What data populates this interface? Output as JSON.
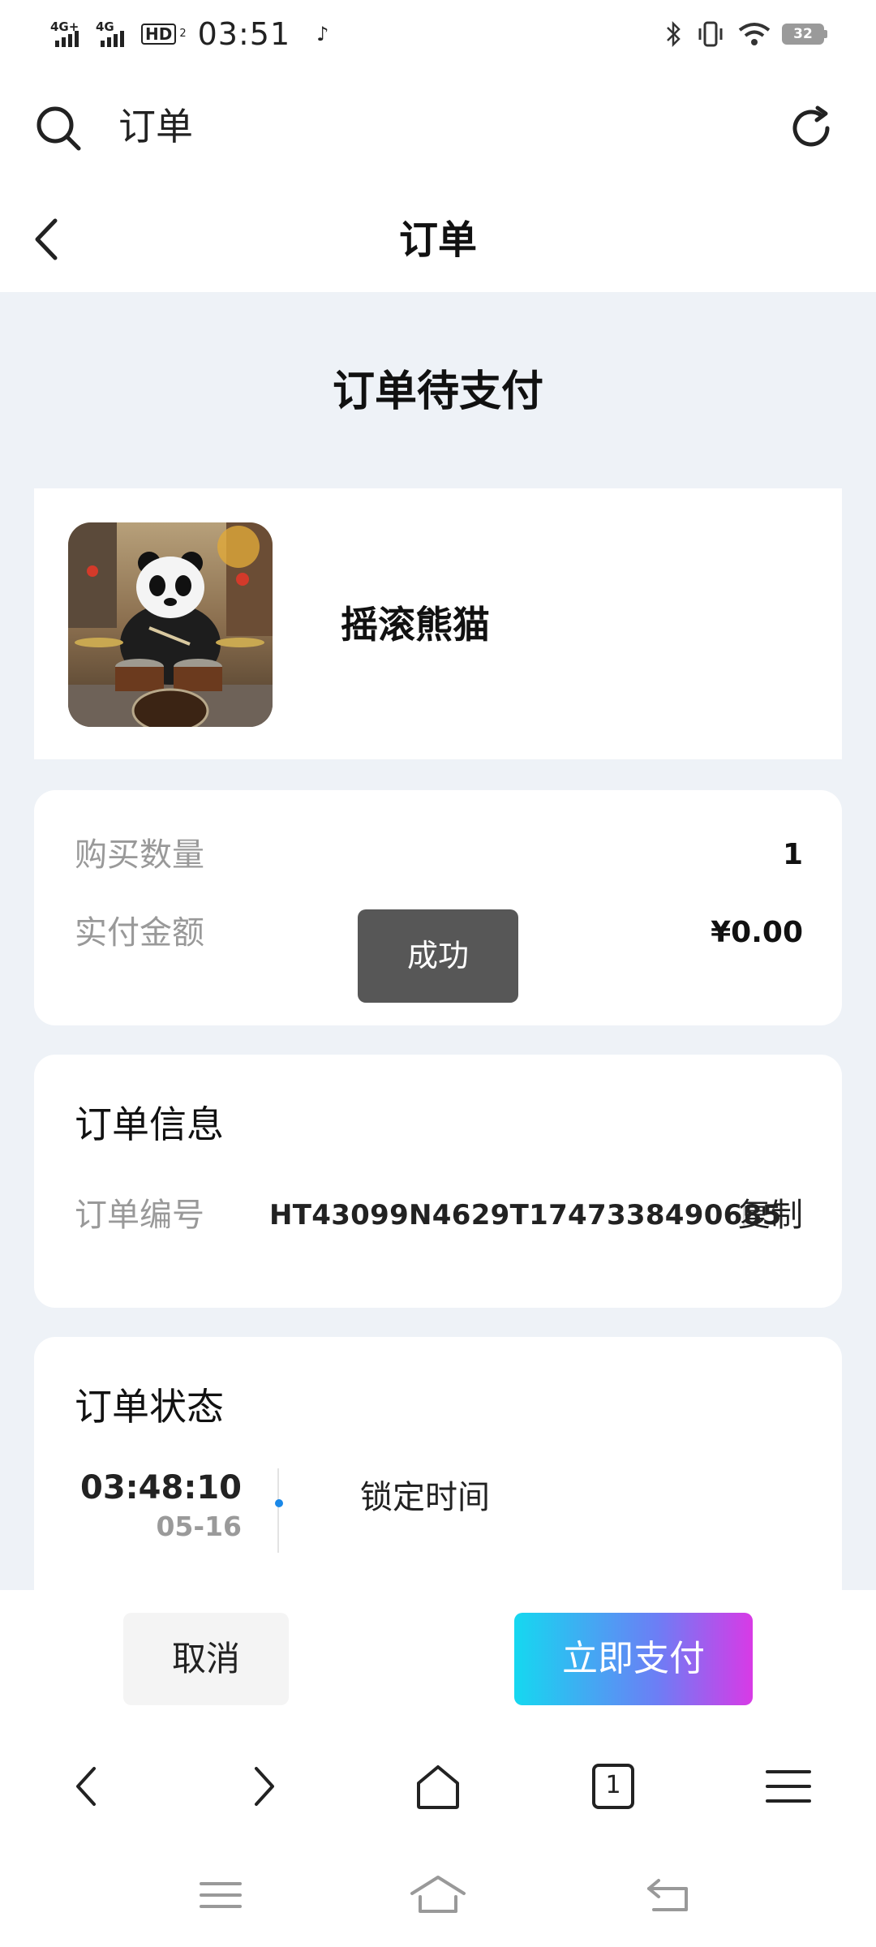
{
  "status_bar": {
    "network_1": "4G+",
    "network_2": "4G",
    "hd_label": "HD",
    "hd_sub": "2",
    "time": "03:51",
    "battery": "32"
  },
  "browser_bar": {
    "url_text": "订单",
    "search_icon": "search-icon",
    "refresh_icon": "refresh-icon"
  },
  "header": {
    "title": "订单",
    "back_icon": "chevron-left-icon"
  },
  "order_status_title": "订单待支付",
  "product": {
    "name": "摇滚熊猫"
  },
  "summary": {
    "quantity_label": "购买数量",
    "quantity_value": "1",
    "amount_label": "实付金额",
    "amount_value": "¥0.00"
  },
  "toast": "成功",
  "order_info": {
    "heading": "订单信息",
    "order_no_label": "订单编号",
    "order_no_value": "HT43099N4629T1747338490685",
    "copy_label": "复制"
  },
  "order_status": {
    "heading": "订单状态",
    "events": [
      {
        "time": "03:48:10",
        "date": "05-16",
        "label": "锁定时间"
      }
    ]
  },
  "actions": {
    "cancel_label": "取消",
    "pay_label": "立即支付",
    "pay_gradient": [
      "#15d8f0",
      "#6c7ef5",
      "#d83ae6"
    ]
  },
  "browser_nav": {
    "tab_count": "1"
  },
  "colors": {
    "page_bg": "#eef2f7",
    "accent": "#1a88e8",
    "toast_bg": "#575757"
  }
}
